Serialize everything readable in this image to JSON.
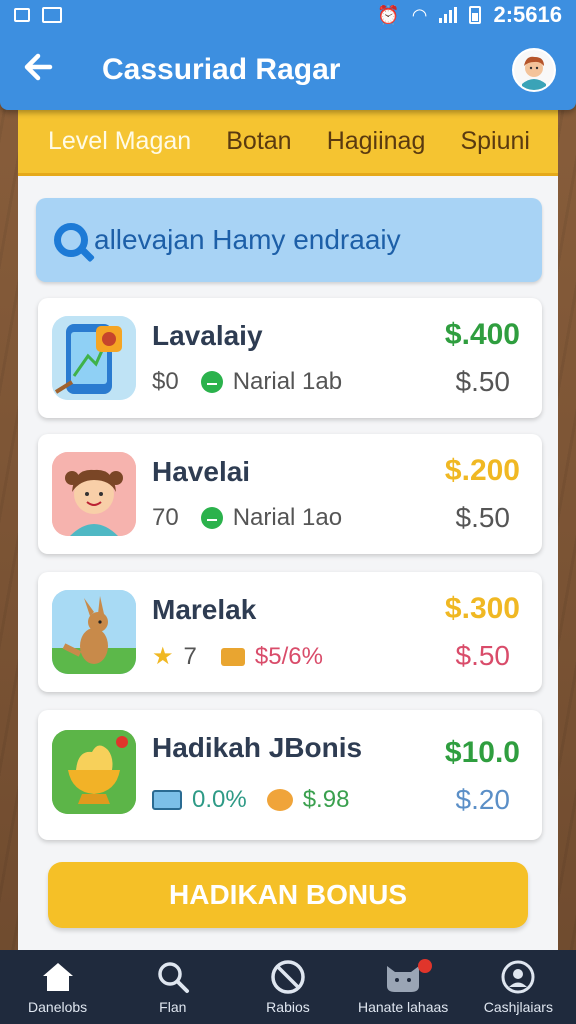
{
  "status_bar": {
    "time": "2:5616"
  },
  "app_bar": {
    "title": "Cassuriad Ragar"
  },
  "tabs": [
    {
      "label": "Level Magan"
    },
    {
      "label": "Botan"
    },
    {
      "label": "Hagiinag"
    },
    {
      "label": "Spiuni"
    }
  ],
  "search": {
    "text": "allevajan Hamy endraaiy"
  },
  "items": [
    {
      "name": "Lavalaiy",
      "sub_value": "$0",
      "sub_label": "Narial 1ab",
      "price": "$.400",
      "price2": "$.50",
      "price_color": "#2f9e3f"
    },
    {
      "name": "Havelai",
      "sub_value": "70",
      "sub_label": "Narial 1ao",
      "price": "$.200",
      "price2": "$.50",
      "price_color": "#f0b823"
    },
    {
      "name": "Marelak",
      "sub_value": "7",
      "sub_label": "$5/6%",
      "price": "$.300",
      "price2": "$.50",
      "price_color": "#f0b823",
      "price2_color": "#d94c6a"
    },
    {
      "name": "Hadikah JBonis",
      "sub_value": "0.0%",
      "sub_label": "$.98",
      "price": "$10.0",
      "price2": "$.20",
      "price_color": "#2f9e3f",
      "price2_color": "#5b8fc7"
    }
  ],
  "bonus_button": {
    "label": "HADIKAN BONUS"
  },
  "bottom_nav": [
    {
      "label": "Danelobs",
      "icon": "home-icon"
    },
    {
      "label": "Flan",
      "icon": "search-icon"
    },
    {
      "label": "Rabios",
      "icon": "no-entry-icon"
    },
    {
      "label": "Hanate lahaas",
      "icon": "cat-icon"
    },
    {
      "label": "Cashjlaiars",
      "icon": "person-icon"
    }
  ]
}
